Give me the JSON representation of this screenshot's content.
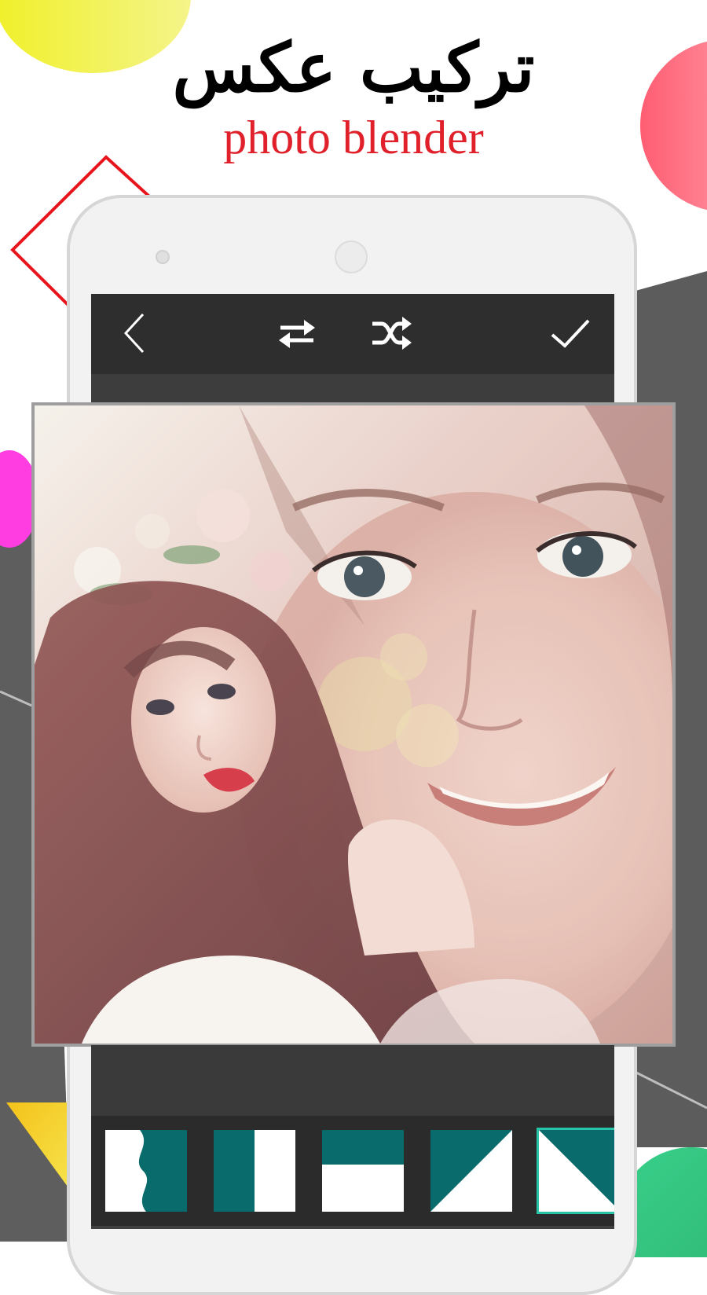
{
  "headline": {
    "title_ar": "تركيب عکس",
    "title_en": "photo blender"
  },
  "colors": {
    "title_en": "#e0202a",
    "accent_teal": "#096b6b",
    "toolbar_bg": "#2e2e2e",
    "screen_bg": "#404040",
    "selected_outline": "#27c4a8"
  },
  "toolbar": {
    "back_icon": "chevron-left-icon",
    "swap_icon": "swap-arrows-icon",
    "shuffle_icon": "shuffle-icon",
    "confirm_icon": "check-icon"
  },
  "mask_strip": {
    "items": [
      {
        "name": "mask-wave-vertical",
        "icon": "wave-split-icon"
      },
      {
        "name": "mask-split-vertical",
        "icon": "vertical-split-icon"
      },
      {
        "name": "mask-split-horizontal",
        "icon": "horizontal-split-icon"
      },
      {
        "name": "mask-diagonal",
        "icon": "diagonal-split-icon"
      },
      {
        "name": "mask-diagonal-reverse",
        "icon": "diagonal-reverse-split-icon",
        "selected": true
      }
    ]
  }
}
